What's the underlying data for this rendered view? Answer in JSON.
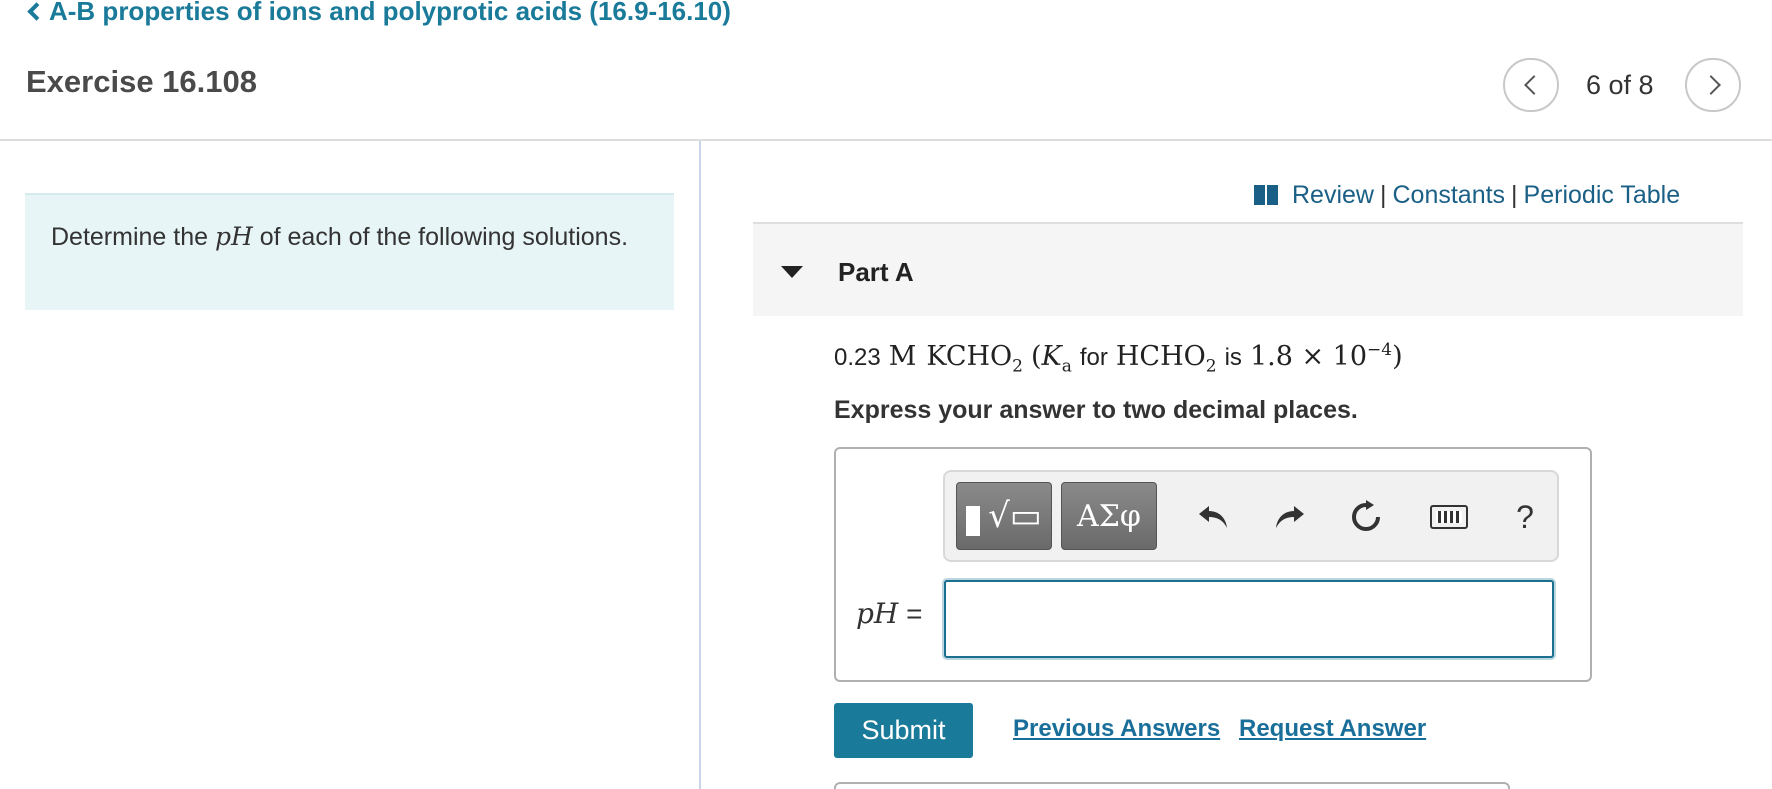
{
  "header": {
    "breadcrumb": "A-B properties of ions and polyprotic acids (16.9-16.10)",
    "exercise_title": "Exercise 16.108",
    "page_counter": "6 of 8"
  },
  "intro": {
    "prefix": "Determine the ",
    "math": "pH",
    "suffix": " of each of the following solutions."
  },
  "resources": {
    "review": "Review",
    "constants": "Constants",
    "periodic_table": "Periodic Table",
    "separator": "|"
  },
  "part": {
    "title": "Part A",
    "question": {
      "conc": "0.23",
      "unit": "M",
      "compound": "KCHO",
      "compound_sub": "2",
      "open": "(",
      "ka": "K",
      "ka_sub": "a",
      "for_text": "for",
      "acid": "HCHO",
      "acid_sub": "2",
      "is_text": "is",
      "ka_value": "1.8 × 10",
      "ka_exp": "−4",
      "close": ")"
    },
    "instruction": "Express your answer to two decimal places."
  },
  "toolbar": {
    "greek_label": "ΑΣφ",
    "help_label": "?"
  },
  "answer": {
    "label_math": "pH",
    "label_eq": " =",
    "value": ""
  },
  "actions": {
    "submit": "Submit",
    "previous_answers": "Previous Answers",
    "request_answer": "Request Answer"
  },
  "colors": {
    "link": "#1a7a99",
    "submit_bg": "#1a7a99",
    "intro_bg": "#e7f5f6"
  }
}
